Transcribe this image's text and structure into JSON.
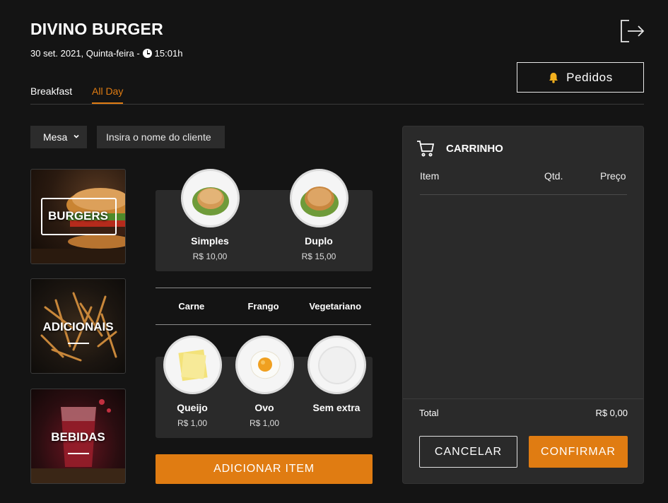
{
  "header": {
    "title": "DIVINO BURGER",
    "date": "30 set. 2021, Quinta-feira -",
    "time": "15:01h",
    "pedidos_label": "Pedidos"
  },
  "tabs": [
    {
      "label": "Breakfast",
      "active": false
    },
    {
      "label": "All Day",
      "active": true
    }
  ],
  "filters": {
    "mesa_label": "Mesa",
    "client_placeholder": "Insira o nome do cliente"
  },
  "categories": [
    {
      "label": "BURGERS"
    },
    {
      "label": "ADICIONAIS"
    },
    {
      "label": "BEBIDAS"
    }
  ],
  "burgers": [
    {
      "name": "Simples",
      "price": "R$ 10,00"
    },
    {
      "name": "Duplo",
      "price": "R$ 15,00"
    }
  ],
  "protein_tabs": [
    "Carne",
    "Frango",
    "Vegetariano"
  ],
  "extras": [
    {
      "name": "Queijo",
      "price": "R$ 1,00"
    },
    {
      "name": "Ovo",
      "price": "R$ 1,00"
    },
    {
      "name": "Sem extra",
      "price": ""
    }
  ],
  "add_button": "ADICIONAR ITEM",
  "cart": {
    "title": "CARRINHO",
    "col_item": "Item",
    "col_qty": "Qtd.",
    "col_price": "Preço",
    "total_label": "Total",
    "total_value": "R$ 0,00",
    "cancel_label": "CANCELAR",
    "confirm_label": "CONFIRMAR"
  },
  "colors": {
    "accent": "#e07c12",
    "background": "#141414",
    "panel": "#2a2a2a"
  }
}
